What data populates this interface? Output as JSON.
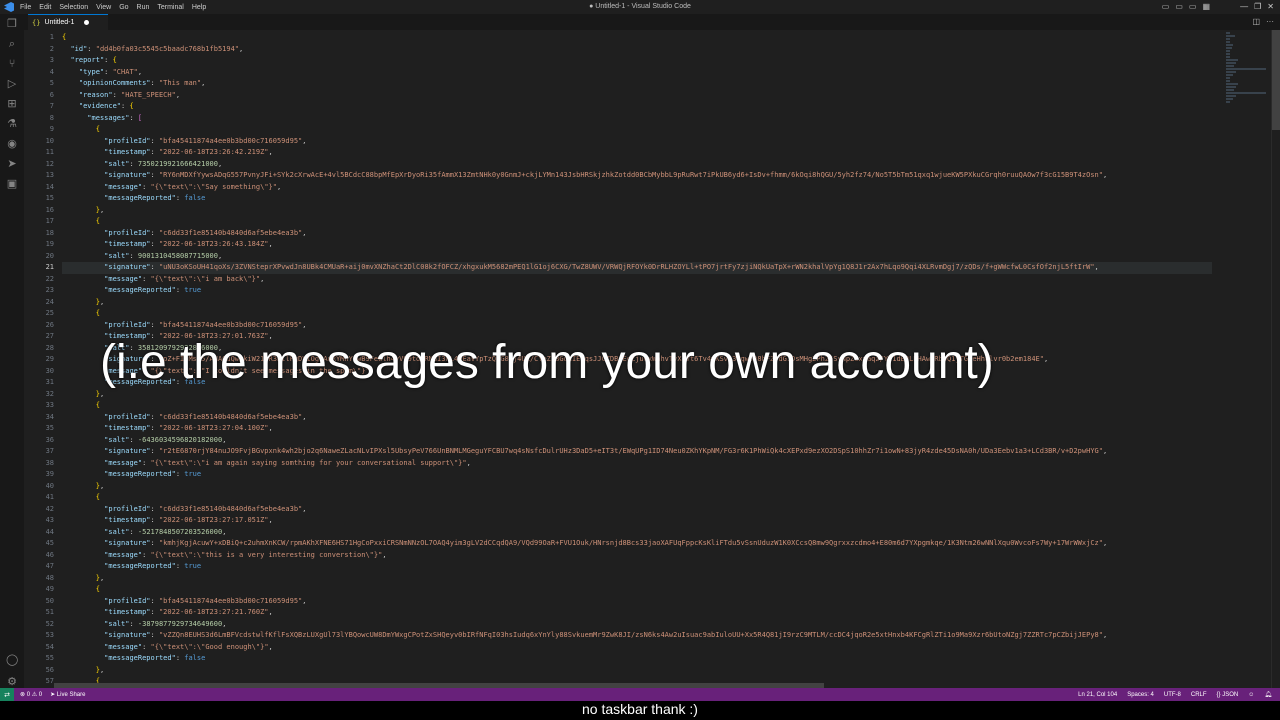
{
  "titlebar": {
    "menu": [
      "File",
      "Edit",
      "Selection",
      "View",
      "Go",
      "Run",
      "Terminal",
      "Help"
    ],
    "window_title": "● Untitled-1 - Visual Studio Code"
  },
  "tab": {
    "label": "Untitled-1"
  },
  "editor": {
    "active_line": 21,
    "lines": [
      {
        "n": 1,
        "t": "{"
      },
      {
        "n": 2,
        "t": "  \"id\": \"dd4b0fa03c5545c5baadc768b1fb5194\","
      },
      {
        "n": 3,
        "t": "  \"report\": {"
      },
      {
        "n": 4,
        "t": "    \"type\": \"CHAT\","
      },
      {
        "n": 5,
        "t": "    \"opinionComments\": \"This man\","
      },
      {
        "n": 6,
        "t": "    \"reason\": \"HATE_SPEECH\","
      },
      {
        "n": 7,
        "t": "    \"evidence\": {"
      },
      {
        "n": 8,
        "t": "      \"messages\": ["
      },
      {
        "n": 9,
        "t": "        {"
      },
      {
        "n": 10,
        "t": "          \"profileId\": \"bfa45411874a4ee0b3bd00c716059d95\","
      },
      {
        "n": 11,
        "t": "          \"timestamp\": \"2022-06-18T23:26:42.219Z\","
      },
      {
        "n": 12,
        "t": "          \"salt\": 7350219921666421000,"
      },
      {
        "n": 13,
        "t": "          \"signature\": \"RY6nMDXfYywsADqG557PvnyJFi+SYk2cXrwAcE+4vl5BCdcC88bpMfEpXrDyoRi35fAmmX13ZmtNHk0y0GnmJ+ckjLYMn143JsbHRSkjzhkZotdd0BCbMybbL9pRuRwt7iPkUB6yd6+IsDv+fhmm/6kOqi8hQGU/5yh2fz74/No5T5bTm51qxq1wjueKW5PXkuCGrqh0ruuQAOw7f3cG15B9T4zOsn\","
      },
      {
        "n": 14,
        "t": "          \"message\": \"{\\\"text\\\":\\\"Say something\\\"}\","
      },
      {
        "n": 15,
        "t": "          \"messageReported\": false"
      },
      {
        "n": 16,
        "t": "        },"
      },
      {
        "n": 17,
        "t": "        {"
      },
      {
        "n": 18,
        "t": "          \"profileId\": \"c6dd33f1e85140b4840d6af5ebe4ea3b\","
      },
      {
        "n": 19,
        "t": "          \"timestamp\": \"2022-06-18T23:26:43.184Z\","
      },
      {
        "n": 20,
        "t": "          \"salt\": 9001310458087715000,"
      },
      {
        "n": 21,
        "t": "          \"signature\": \"uNU3oKSoUH41qoXs/3ZVNSteprXPvwdJn8UBk4CMUaR+aij0mvXNZhaCt2DlC08k2fOFCZ/xhgxukM5682mPEQ1lG1oj6CXG/TwZ8UWV/VRWQjRFOYk0DrRLHZOYLl+tPO7jrtFy7zjiNQkUaTpX+rWN2khalVpYg1Q8J1r2Ax7hLqo9Qqi4XLRvmDgj7/zQDs/f+gWWcfwL0CsfOf2njL5ftIrW\","
      },
      {
        "n": 22,
        "t": "          \"message\": \"{\\\"text\\\":\\\"i am back\\\"}\","
      },
      {
        "n": 23,
        "t": "          \"messageReported\": true"
      },
      {
        "n": 24,
        "t": "        },"
      },
      {
        "n": 25,
        "t": "        {"
      },
      {
        "n": 26,
        "t": "          \"profileId\": \"bfa45411874a4ee0b3bd00c716059d95\","
      },
      {
        "n": 27,
        "t": "          \"timestamp\": \"2022-06-18T23:27:01.763Z\","
      },
      {
        "n": 28,
        "t": "          \"salt\": 3581209792922816000,"
      },
      {
        "n": 29,
        "t": "          \"signature\": \"pZ+FI6MsJ5/ANA6uQwpkiW21pR3KIlFgDVIOg6AuRYMnYqwB9Fewlh4yVU9tdfRNGI3hL4wEaVYpTzQfG8Vj4Uk/CYeZ28GdNIEuqsJJCZDBzEdZju6xWhhvTvX4Vt6Tv4wKSvx3xqwoD8bFZDdG1DsMHg2Ph26SvNpZ6xvaqz/Yh1dB0LNHAwmRb0Q1yTGNeHh8lvr0b2em184E\","
      },
      {
        "n": 30,
        "t": "          \"message\": \"{\\\"text\\\":\\\"I couldn't see messages in the spam\\\"}\","
      },
      {
        "n": 31,
        "t": "          \"messageReported\": false"
      },
      {
        "n": 32,
        "t": "        },"
      },
      {
        "n": 33,
        "t": "        {"
      },
      {
        "n": 34,
        "t": "          \"profileId\": \"c6dd33f1e85140b4840d6af5ebe4ea3b\","
      },
      {
        "n": 35,
        "t": "          \"timestamp\": \"2022-06-18T23:27:04.100Z\","
      },
      {
        "n": 36,
        "t": "          \"salt\": -6436034596820182000,"
      },
      {
        "n": 37,
        "t": "          \"signature\": \"r2tE6870rjY84nuJO9FvjBGvpxnk4wh2bjo2q6NaweZLacNLvIPXsl5UbsyPeV766UnBNMLMGeguYFCBU7wq4sNsfcDulrUHz3DaD5+eIT3t/EWqUPg1ID74Neu0ZKhYKpNM/FG3r6K1PhWiQk4cXEPxd9ezXO2DSpS10hhZr7i1owN+83jyR4zde45DsNA0h/UDa3Eebv1a3+LCd3BR/v+D2pwHYG\","
      },
      {
        "n": 38,
        "t": "          \"message\": \"{\\\"text\\\":\\\"i am again saying somthing for your conversational support\\\"}\","
      },
      {
        "n": 39,
        "t": "          \"messageReported\": true"
      },
      {
        "n": 40,
        "t": "        },"
      },
      {
        "n": 41,
        "t": "        {"
      },
      {
        "n": 42,
        "t": "          \"profileId\": \"c6dd33f1e85140b4840d6af5ebe4ea3b\","
      },
      {
        "n": 43,
        "t": "          \"timestamp\": \"2022-06-18T23:27:17.051Z\","
      },
      {
        "n": 44,
        "t": "          \"salt\": -5217848507203526000,"
      },
      {
        "n": 45,
        "t": "          \"signature\": \"kmhjKgjAcuwY+xDBiQ+c2uhmXnKCW/rpmAKhXFNE6HS71HgCoPxxiCRSNmNNzOL7OAQ4yim3gLV2dCCqdQA9/VQd99OaR+FVU1Ouk/HNrsnjd8Bcs33jaoXAFUqFppcKsKliFTdu5vSsnUduzW1K0XCcsQ8mw9Qgrxxzcdmo4+E80m6d7YXpgmkqe/1K3Ntm26wNNlXqu0WvcoFs7Wy+17WrWWxjCz\","
      },
      {
        "n": 46,
        "t": "          \"message\": \"{\\\"text\\\":\\\"this is a very interesting converstion\\\"}\","
      },
      {
        "n": 47,
        "t": "          \"messageReported\": true"
      },
      {
        "n": 48,
        "t": "        },"
      },
      {
        "n": 49,
        "t": "        {"
      },
      {
        "n": 50,
        "t": "          \"profileId\": \"bfa45411874a4ee0b3bd00c716059d95\","
      },
      {
        "n": 51,
        "t": "          \"timestamp\": \"2022-06-18T23:27:21.760Z\","
      },
      {
        "n": 52,
        "t": "          \"salt\": -3879877929734649600,"
      },
      {
        "n": 53,
        "t": "          \"signature\": \"vZZQn8EUHS3d6LmBFVcdstwlfKflFsXQBzLUXgUl73lYBQowcUW8DmYWxgCPotZxSHQeyv0bIRfNFqI03hsIudq6xYnYly88SvkuemMr9ZwK8JI/zsN6ks4Aw2uIsuac9abIuloUU+Xx5R4Q81jI9rzC9MTLM/ccDC4jqoR2e5xtHnxb4KFCgRlZTi1o9Ma9Xzr6bUtoNZgj7ZZRTc7pCZbijJEPy8\","
      },
      {
        "n": 54,
        "t": "          \"message\": \"{\\\"text\\\":\\\"Good enough\\\"}\","
      },
      {
        "n": 55,
        "t": "          \"messageReported\": false"
      },
      {
        "n": 56,
        "t": "        },"
      },
      {
        "n": 57,
        "t": "        {"
      }
    ]
  },
  "overlay": {
    "text": "(i.e the messages from your own account)"
  },
  "statusbar": {
    "problems": "⊗ 0 ⚠ 0",
    "live_share": "Live Share",
    "position": "Ln 21, Col 104",
    "spaces": "Spaces: 4",
    "encoding": "UTF-8",
    "eol": "CRLF",
    "language": "{} JSON"
  },
  "caption": {
    "text": "no taskbar thank :)"
  }
}
